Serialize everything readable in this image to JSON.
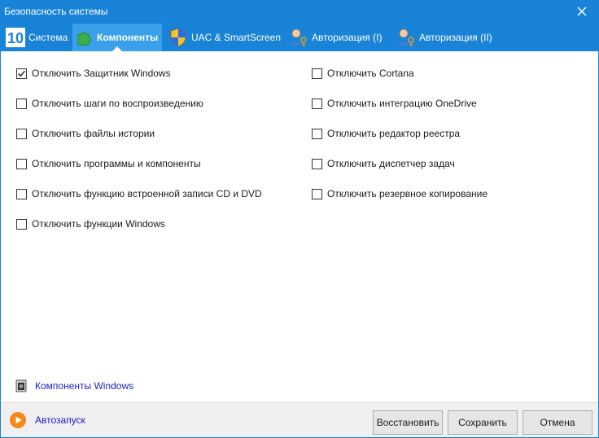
{
  "window": {
    "title": "Безопасность системы"
  },
  "tabs": [
    {
      "label": "Система",
      "active": false
    },
    {
      "label": "Компоненты",
      "active": true
    },
    {
      "label": "UAC & SmartScreen",
      "active": false
    },
    {
      "label": "Авторизация (I)",
      "active": false
    },
    {
      "label": "Авторизация (II)",
      "active": false
    }
  ],
  "options": {
    "left": [
      {
        "label": "Отключить Защитник Windows",
        "checked": true
      },
      {
        "label": "Отключить шаги по воспроизведению",
        "checked": false
      },
      {
        "label": "Отключить файлы истории",
        "checked": false
      },
      {
        "label": "Отключить программы и компоненты",
        "checked": false
      },
      {
        "label": "Отключить функцию встроенной записи CD и DVD",
        "checked": false
      },
      {
        "label": "Отключить функции Windows",
        "checked": false
      }
    ],
    "right": [
      {
        "label": "Отключить Cortana",
        "checked": false
      },
      {
        "label": "Отключить интеграцию OneDrive",
        "checked": false
      },
      {
        "label": "Отключить редактор реестра",
        "checked": false
      },
      {
        "label": "Отключить диспетчер задач",
        "checked": false
      },
      {
        "label": "Отключить резервное копирование",
        "checked": false
      }
    ]
  },
  "components_link": "Компоненты Windows",
  "footer": {
    "autorun_label": "Автозапуск",
    "restore_label": "Восстановить",
    "save_label": "Сохранить",
    "cancel_label": "Отмена"
  },
  "colors": {
    "titlebar": "#1883d7",
    "active_tab": "#3aa0ea",
    "link": "#1a1acc",
    "autorun_icon": "#f7891c"
  }
}
